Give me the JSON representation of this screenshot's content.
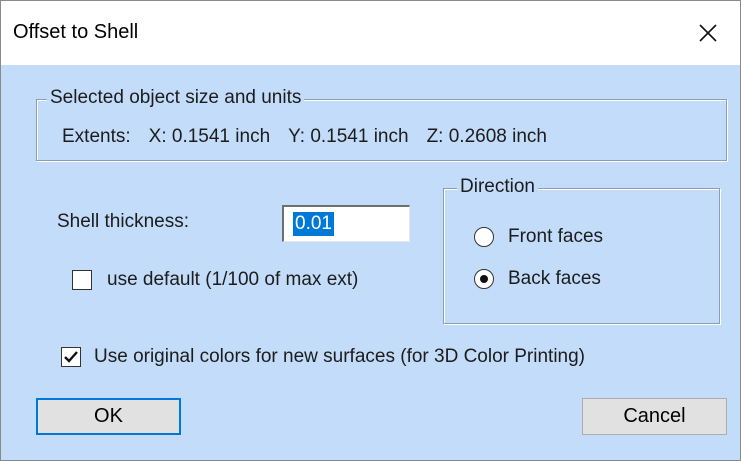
{
  "window": {
    "title": "Offset to Shell",
    "close_icon": "close-x-icon"
  },
  "size_group": {
    "legend": "Selected object size and units",
    "extents_label": "Extents:",
    "x": "X: 0.1541 inch",
    "y": "Y: 0.1541 inch",
    "z": "Z: 0.2608 inch"
  },
  "shell": {
    "label": "Shell thickness:",
    "value": "0.01",
    "use_default_label": "use default (1/100 of max ext)",
    "use_default_checked": false
  },
  "direction": {
    "legend": "Direction",
    "front_label": "Front faces",
    "back_label": "Back faces",
    "selected": "back"
  },
  "colors_option": {
    "label": "Use original colors for new surfaces (for 3D Color Printing)",
    "checked": true
  },
  "buttons": {
    "ok": "OK",
    "cancel": "Cancel"
  },
  "colors": {
    "dialog_bg": "#c3dcfa",
    "selection": "#0078d7"
  }
}
